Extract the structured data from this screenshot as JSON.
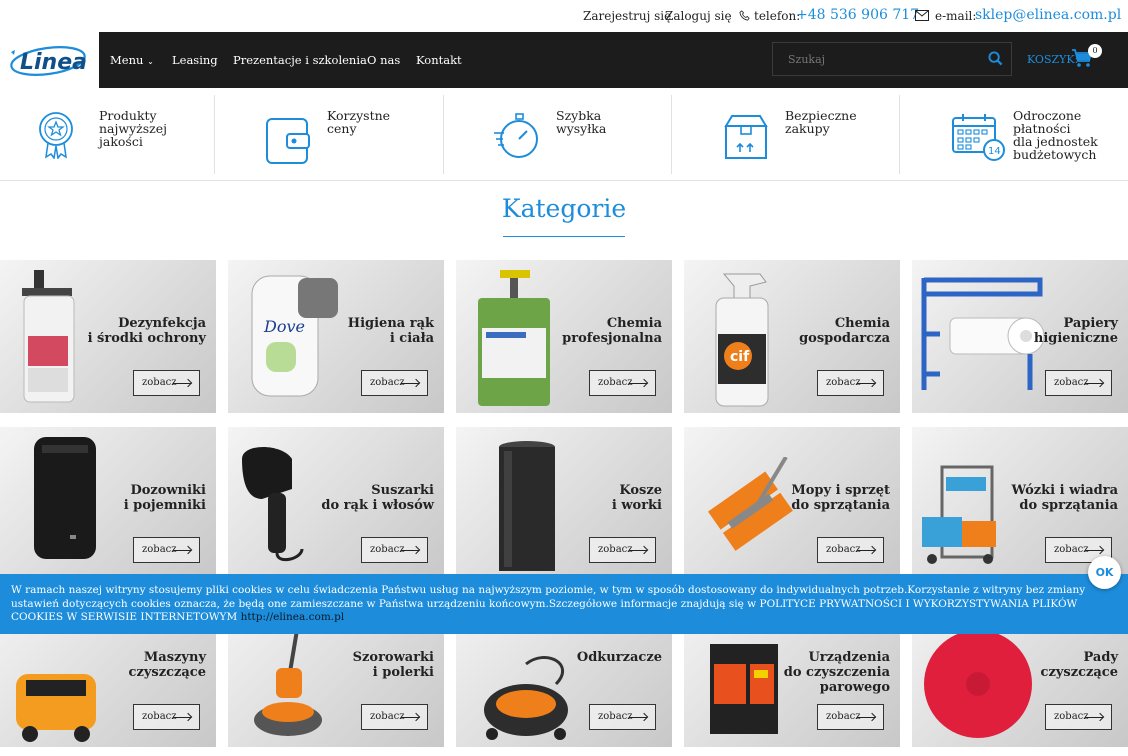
{
  "topbar": {
    "register": "Zarejestruj się",
    "login": "Zaloguj się",
    "phone_label": "telefon:",
    "phone": "+48 536 906 717",
    "email_label": "e-mail:",
    "email": "sklep@elinea.com.pl"
  },
  "logo": {
    "text": "Linea"
  },
  "nav": {
    "items": [
      "Menu",
      "Leasing",
      "Prezentacje i szkolenia",
      "O nas",
      "Kontakt"
    ],
    "search_placeholder": "Szukaj",
    "cart_label": "KOSZYK:",
    "cart_count": "0"
  },
  "features": [
    {
      "icon": "award-badge-icon",
      "text": "Produkty\nnajwyższej jakości"
    },
    {
      "icon": "wallet-icon",
      "text": "Korzystne\nceny"
    },
    {
      "icon": "stopwatch-icon",
      "text": "Szybka\nwysyłka"
    },
    {
      "icon": "package-box-icon",
      "text": "Bezpieczne\nzakupy"
    },
    {
      "icon": "calendar-14-icon",
      "text": "Odroczone\npłatności\ndla jednostek\nbudżetowych"
    }
  ],
  "section_title": "Kategorie",
  "button_label": "zobacz",
  "categories": [
    {
      "name": "Dezynfekcja\ni środki ochrony"
    },
    {
      "name": "Higiena rąk\ni ciała"
    },
    {
      "name": "Chemia\nprofesjonalna"
    },
    {
      "name": "Chemia\ngospodarcza"
    },
    {
      "name": "Papiery\nhigieniczne"
    },
    {
      "name": "Dozowniki\ni pojemniki"
    },
    {
      "name": "Suszarki\ndo rąk i włosów"
    },
    {
      "name": "Kosze\ni worki"
    },
    {
      "name": "Mopy i sprzęt\ndo sprzątania"
    },
    {
      "name": "Wózki i wiadra\ndo sprzątania"
    },
    {
      "name": "Maszyny\nczyszczące"
    },
    {
      "name": "Szorowarki\ni polerki"
    },
    {
      "name": "Odkurzacze"
    },
    {
      "name": "Urządzenia\ndo czyszczenia\nparowego"
    },
    {
      "name": "Pady\nczyszczące"
    }
  ],
  "cookie": {
    "text": "W ramach naszej witryny stosujemy pliki cookies w celu świadczenia Państwu usług na najwyższym poziomie, w tym w sposób dostosowany do indywidualnych potrzeb.Korzystanie z witryny bez zmiany ustawień dotyczących cookies oznacza, że będą one zamieszczane w Państwa urządzeniu końcowym.Szczegółowe informacje znajdują się w POLITYCE PRYWATNOŚCI I WYKORZYSTYWANIA PLIKÓW COOKIES W SERWISIE INTERNETOWYM ",
    "link": "http://elinea.com.pl",
    "ok": "OK"
  },
  "colors": {
    "accent": "#1d8ddb",
    "navbar": "#1c1c1c"
  }
}
